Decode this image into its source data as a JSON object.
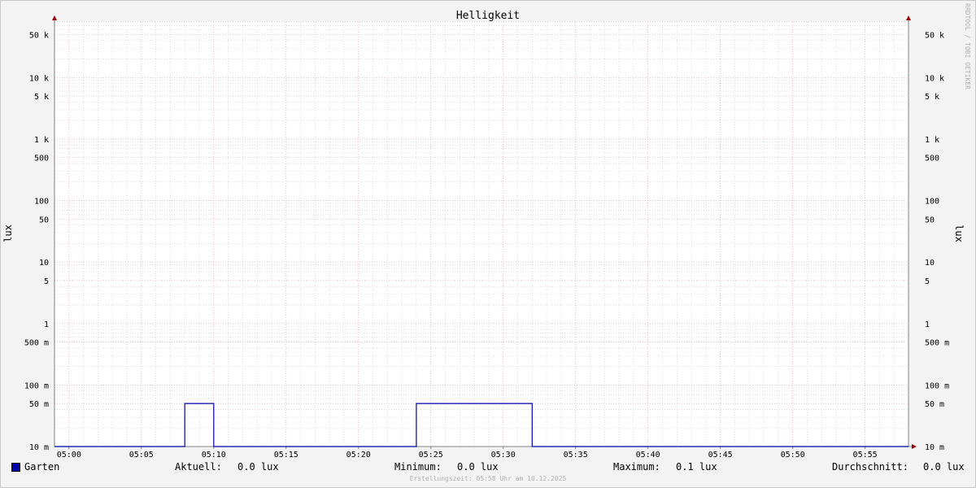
{
  "chart_data": {
    "type": "line",
    "title": "Helligkeit",
    "ylabel": "lux",
    "ylabel_right": "lux",
    "y_scale": "log",
    "ylim": [
      0.01,
      80000
    ],
    "xlim": [
      "04:59",
      "05:58"
    ],
    "x_ticks": [
      "05:00",
      "05:05",
      "05:10",
      "05:15",
      "05:20",
      "05:25",
      "05:30",
      "05:35",
      "05:40",
      "05:45",
      "05:50",
      "05:55"
    ],
    "y_ticks": [
      {
        "value": 50000,
        "label": "50 k"
      },
      {
        "value": 10000,
        "label": "10 k"
      },
      {
        "value": 5000,
        "label": "5 k"
      },
      {
        "value": 1000,
        "label": "1 k"
      },
      {
        "value": 500,
        "label": "500"
      },
      {
        "value": 100,
        "label": "100"
      },
      {
        "value": 50,
        "label": "50"
      },
      {
        "value": 10,
        "label": "10"
      },
      {
        "value": 5,
        "label": "5"
      },
      {
        "value": 1,
        "label": "1"
      },
      {
        "value": 0.5,
        "label": "500 m"
      },
      {
        "value": 0.1,
        "label": "100 m"
      },
      {
        "value": 0.05,
        "label": "50 m"
      },
      {
        "value": 0.01,
        "label": "10 m"
      }
    ],
    "grid": true,
    "legend_position": "bottom",
    "series": [
      {
        "name": "Garten",
        "color": "#0000aa",
        "x": [
          "04:59",
          "05:08",
          "05:08",
          "05:10",
          "05:10",
          "05:24",
          "05:24",
          "05:32",
          "05:32",
          "05:58"
        ],
        "values": [
          0.01,
          0.01,
          0.05,
          0.05,
          0.01,
          0.01,
          0.05,
          0.05,
          0.01,
          0.01
        ]
      }
    ]
  },
  "legend": {
    "series_name": "Garten",
    "current_label": "Aktuell:",
    "current_value": "0.0 lux",
    "min_label": "Minimum:",
    "min_value": "0.0 lux",
    "max_label": "Maximum:",
    "max_value": "0.1 lux",
    "avg_label": "Durchschnitt:",
    "avg_value": "0.0 lux"
  },
  "side_label": "RRDTOOL / TOBI OETIKER",
  "footer": "Erstellungszeit: 05:58 Uhr am 10.12.2025",
  "colors": {
    "line": "#0000aa",
    "major_grid": "#e4a0b0",
    "minor_grid": "#d0d0d0",
    "axis": "#808080",
    "arrow": "#990000"
  }
}
